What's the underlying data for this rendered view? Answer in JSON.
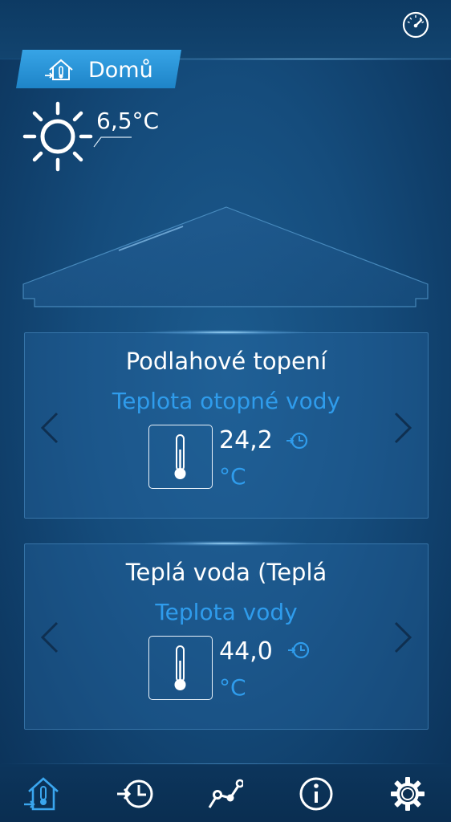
{
  "header": {
    "home_tab_label": "Domů",
    "icons": [
      "compass-icon",
      "house-thermometer-icon"
    ]
  },
  "weather": {
    "icon": "sun-icon",
    "outdoor_temperature": "6,5°C"
  },
  "circuits": [
    {
      "name": "Podlahové topení",
      "metric": "Teplota otopné vody",
      "value": "24,2",
      "unit": "°C",
      "icons": [
        "thermometer-icon",
        "clock-icon",
        "chevron-left-icon",
        "chevron-right-icon"
      ]
    },
    {
      "name": "Teplá voda (Teplá",
      "metric": "Teplota vody",
      "value": "44,0",
      "unit": "°C",
      "icons": [
        "thermometer-icon",
        "clock-icon",
        "chevron-left-icon",
        "chevron-right-icon"
      ]
    }
  ],
  "bottom_nav": [
    {
      "icon": "home-thermometer-icon",
      "active": true
    },
    {
      "icon": "history-clock-icon",
      "active": false
    },
    {
      "icon": "chart-line-icon",
      "active": false
    },
    {
      "icon": "info-icon",
      "active": false
    },
    {
      "icon": "settings-gear-icon",
      "active": false
    }
  ],
  "colors": {
    "background": "#154c7c",
    "accent_blue": "#2f9cec",
    "home_tab": "#2a93d6",
    "text": "#ffffff"
  }
}
